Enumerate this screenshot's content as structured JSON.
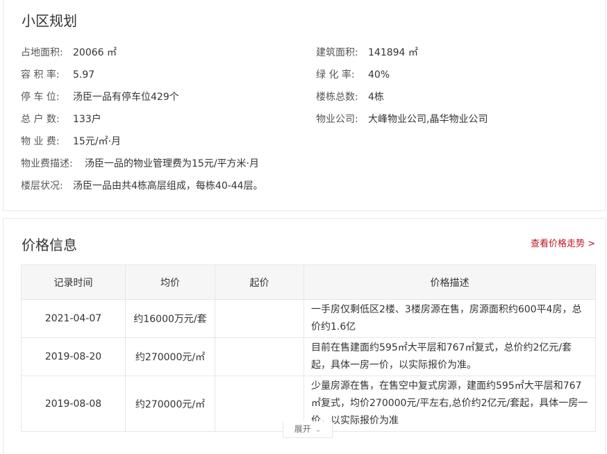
{
  "plan": {
    "title": "小区规划",
    "land_area_label": "占地面积:",
    "land_area_value": "20066 ㎡",
    "building_area_label": "建筑面积:",
    "building_area_value": "141894 ㎡",
    "plot_ratio_label": "容 积 率:",
    "plot_ratio_value": "5.97",
    "green_ratio_label": "绿 化 率:",
    "green_ratio_value": "40%",
    "parking_label": "停 车 位:",
    "parking_value": "汤臣一品有停车位429个",
    "buildings_label": "楼栋总数:",
    "buildings_value": "4栋",
    "households_label": "总 户 数:",
    "households_value": "133户",
    "property_company_label": "物业公司:",
    "property_company_value": "大峰物业公司,晶华物业公司",
    "fee_label": "物 业 费:",
    "fee_value": "15元/㎡·月",
    "fee_desc_label": "物业费描述:",
    "fee_desc_value": "汤臣一品的物业管理费为15元/平方米·月",
    "floors_label": "楼层状况:",
    "floors_value": "汤臣一品由共4栋高层组成，每栋40-44层。"
  },
  "price": {
    "title": "价格信息",
    "trend_link": "查看价格走势 >",
    "headers": [
      "记录时间",
      "均价",
      "起价",
      "价格描述"
    ],
    "rows": [
      {
        "date": "2021-04-07",
        "avg": "约16000万元/套",
        "start": "",
        "desc_lines": [
          "一手房仅剩低区2楼、3楼房源在售，房源面积约600平4房，总",
          "价约1.6亿"
        ]
      },
      {
        "date": "2019-08-20",
        "avg": "约270000元/㎡",
        "start": "",
        "desc_lines": [
          "目前在售建面约595㎡大平层和767㎡复式，总价约2亿元/套",
          "起，具体一房一价，以实际报价为准。"
        ]
      },
      {
        "date": "2019-08-08",
        "avg": "约270000元/㎡",
        "start": "",
        "desc_lines": [
          "少量房源在售，在售空中复式房源，建面约595㎡大平层和767",
          "㎡复式，均价270000元/平左右,总价约2亿元/套起，具体一房一",
          "价，以实际报价为准"
        ]
      }
    ],
    "expand_label": "展开"
  },
  "icons": {
    "expand_icon": "chevron-down-icon"
  },
  "colors": {
    "link": "#c0111d",
    "header_bg": "#f6f6f6",
    "border": "#e6e6e6"
  }
}
